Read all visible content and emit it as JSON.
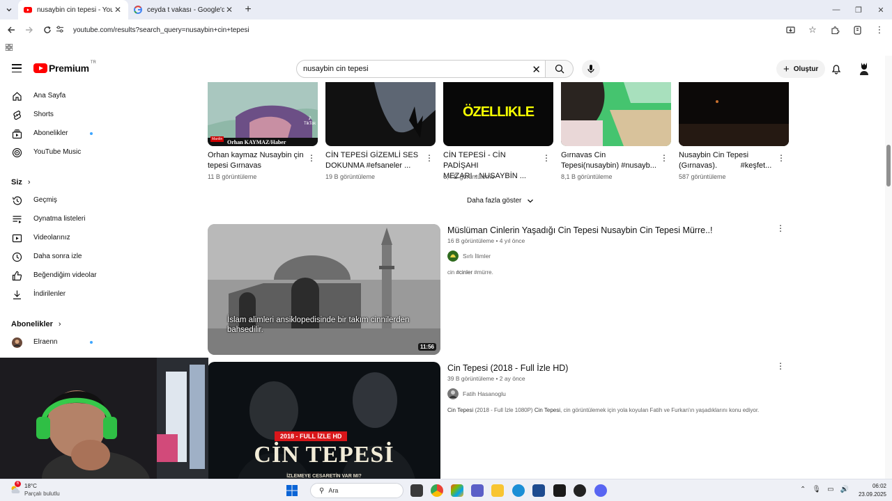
{
  "browser": {
    "tabs": [
      {
        "title": "nusaybin cin tepesi - YouTube",
        "active": true
      },
      {
        "title": "ceyda t vakası - Google'da Ara",
        "active": false
      }
    ],
    "url": "youtube.com/results?search_query=nusaybin+cin+tepesi"
  },
  "header": {
    "logo_word": "Premium",
    "logo_region": "TR",
    "search_query": "nusaybin cin tepesi",
    "create_label": "Oluştur"
  },
  "sidebar": {
    "main": [
      {
        "label": "Ana Sayfa",
        "icon": "home-icon"
      },
      {
        "label": "Shorts",
        "icon": "shorts-icon"
      },
      {
        "label": "Abonelikler",
        "icon": "subscriptions-icon",
        "dot": true
      },
      {
        "label": "YouTube Music",
        "icon": "music-icon"
      }
    ],
    "you_heading": "Siz",
    "you": [
      {
        "label": "Geçmiş",
        "icon": "history-icon"
      },
      {
        "label": "Oynatma listeleri",
        "icon": "playlist-icon"
      },
      {
        "label": "Videolarınız",
        "icon": "your-videos-icon"
      },
      {
        "label": "Daha sonra izle",
        "icon": "watch-later-icon"
      },
      {
        "label": "Beğendiğim videolar",
        "icon": "like-icon"
      },
      {
        "label": "İndirilenler",
        "icon": "download-icon"
      }
    ],
    "subs_heading": "Abonelikler",
    "subs": [
      {
        "label": "Elraenn",
        "dot": true
      }
    ]
  },
  "shorts": [
    {
      "title_line1": "Orhan kaymaz Nusaybin çin",
      "title_line2": "tepesi Gırnavas",
      "views": "11 B görüntüleme",
      "overlay": "Orhan KAYMAZ/Haber",
      "badge": "TikTok"
    },
    {
      "title_line1": "CİN TEPESİ GİZEMLİ SES",
      "title_line2": "DOKUNMA #efsaneler ...",
      "views": "19 B görüntüleme"
    },
    {
      "title_line1": "CİN TEPESİ - CİN PADİŞAHI",
      "title_line2": "MEZARI - NUSAYBİN ...",
      "views": "6,4 B görüntüleme",
      "overlay": "ÖZELLIKLE"
    },
    {
      "title_line1": "Gırnavas Cin",
      "title_line2": "Tepesi(nusaybin) #nusayb...",
      "views": "8,1 B görüntüleme"
    },
    {
      "title_line1": "Nusaybin Cin Tepesi",
      "title_line2": "(Gırnavas).           #keşfet...",
      "views": "587 görüntüleme"
    }
  ],
  "show_more": "Daha fazla göster",
  "videos": [
    {
      "title": "Müslüman Cinlerin Yaşadığı Cin Tepesi Nusaybin Cin Tepesi Mürre..!",
      "meta": "16 B görüntüleme • 4 yıl önce",
      "channel": "Sırlı İlimler",
      "desc_plain1": "cin ",
      "desc_hl": "#cinler",
      "desc_plain2": " #mürre.",
      "duration": "11:56",
      "caption_line1": "İslam alimleri ansiklopedisinde bir takım cinnilerden",
      "caption_line2": "bahsedilir."
    },
    {
      "title": "Cin Tepesi (2018 - Full İzle HD)",
      "meta": "39 B görüntüleme • 2 ay önce",
      "channel": "Fatih Hasanoglu",
      "desc_b1": "Cin Tepesi",
      "desc_p1": " (2018 - Full İzle 1080P) ",
      "desc_b2": "Cin Tepesi",
      "desc_p2": ", cin görüntülemek için yola koyulan Fatih ve Furkan'ın yaşadıklarını konu ediyor.",
      "banner": "2018 - FULL İZLE HD",
      "big_title": "CİN TEPESİ",
      "tagline": "İZLEMEYE CESARETİN VAR MI?"
    }
  ],
  "taskbar": {
    "weather_temp": "18°C",
    "weather_desc": "Parçalı bulutlu",
    "weather_badge": "6",
    "search_label": "Ara",
    "time": "06:02",
    "date": "23.09.2025"
  },
  "colors": {
    "youtube_red": "#ff0000",
    "link_blue": "#3ea6ff"
  }
}
